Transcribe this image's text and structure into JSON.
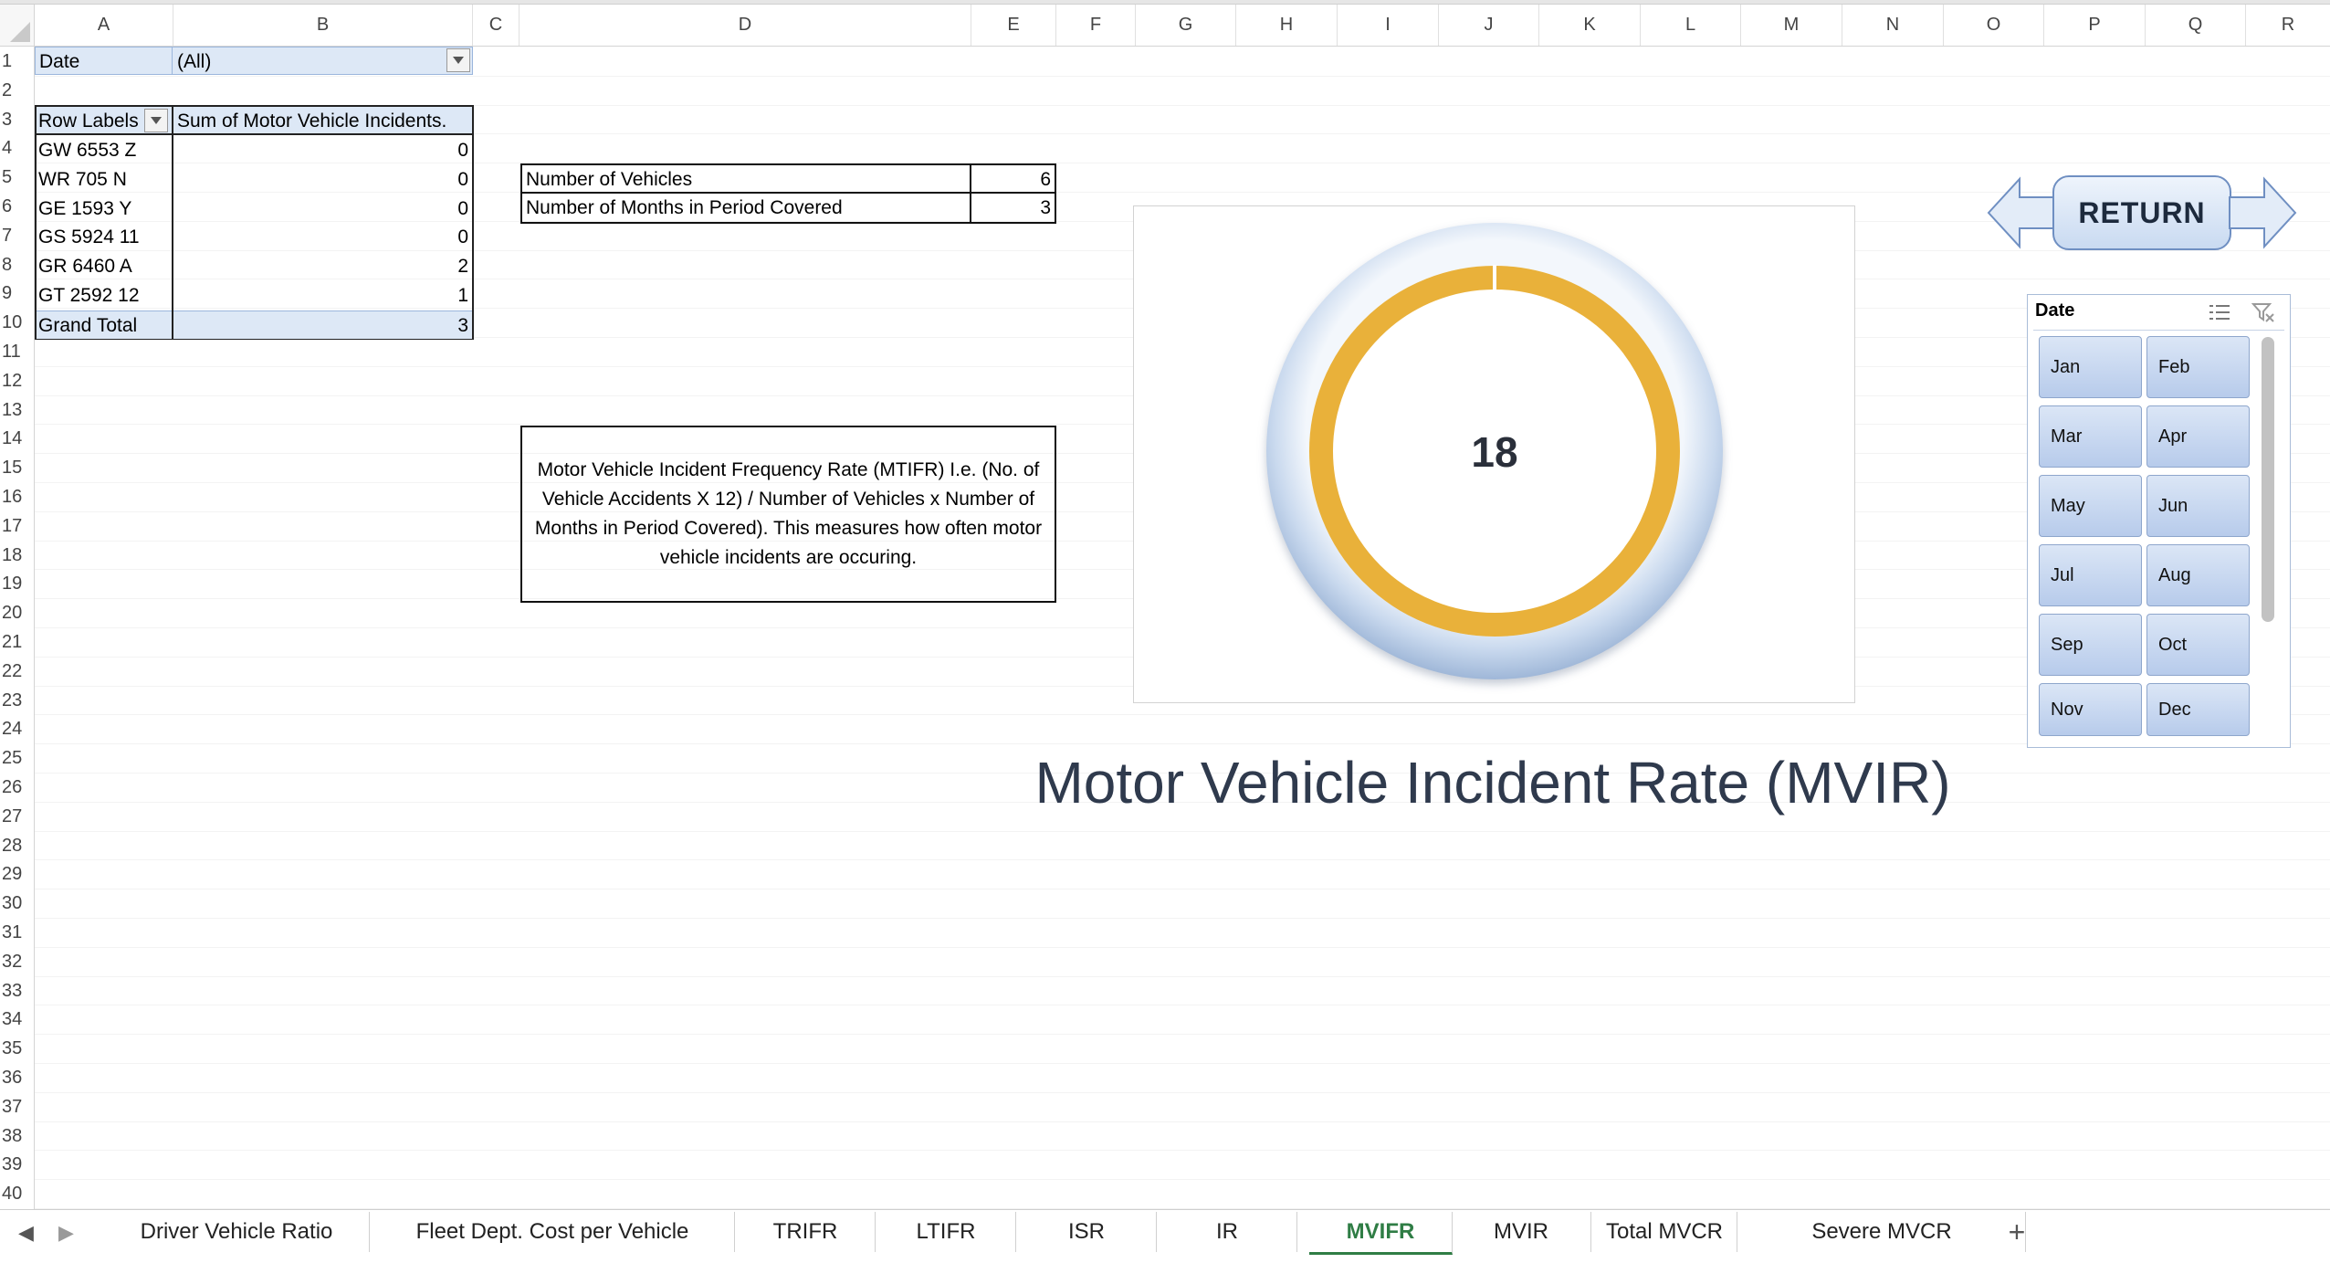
{
  "columns": [
    "A",
    "B",
    "C",
    "D",
    "E",
    "F",
    "G",
    "H",
    "I",
    "J",
    "K",
    "L",
    "M",
    "N",
    "O",
    "P",
    "Q",
    "R"
  ],
  "rows": [
    "1",
    "2",
    "3",
    "4",
    "5",
    "6",
    "7",
    "8",
    "9",
    "10",
    "11",
    "12",
    "13",
    "14",
    "15",
    "16",
    "17",
    "18",
    "19",
    "20",
    "21",
    "22",
    "23",
    "24",
    "25",
    "26",
    "27",
    "28",
    "29",
    "30",
    "31",
    "32",
    "33",
    "34",
    "35",
    "36",
    "37",
    "38",
    "39",
    "40"
  ],
  "pivot": {
    "filter_label": "Date",
    "filter_value": "(All)",
    "row_labels_header": "Row Labels",
    "sum_header": "Sum of Motor Vehicle Incidents.",
    "items": [
      {
        "label": "GW 6553 Z",
        "value": "0"
      },
      {
        "label": "WR 705 N",
        "value": "0"
      },
      {
        "label": "GE 1593 Y",
        "value": "0"
      },
      {
        "label": "GS 5924 11",
        "value": "0"
      },
      {
        "label": "GR 6460 A",
        "value": "2"
      },
      {
        "label": "GT 2592 12",
        "value": "1"
      }
    ],
    "grand_total_label": "Grand Total",
    "grand_total_value": "3"
  },
  "info": {
    "vehicles_label": "Number of Vehicles",
    "vehicles_value": "6",
    "months_label": "Number of Months in Period Covered",
    "months_value": "3"
  },
  "description": "Motor Vehicle Incident Frequency Rate (MTIFR) I.e. (No. of Vehicle Accidents X 12) / Number of Vehicles x Number of Months in Period Covered). This measures how often motor vehicle incidents are occuring.",
  "gauge": {
    "value": "18",
    "ring_color": "#e9b13a",
    "outer_color": "#c4d6ec"
  },
  "chart_title": "Motor Vehicle Incident Rate (MVIR)",
  "return_button": "RETURN",
  "slicer": {
    "title": "Date",
    "months": [
      "Jan",
      "Feb",
      "Mar",
      "Apr",
      "May",
      "Jun",
      "Jul",
      "Aug",
      "Sep",
      "Oct",
      "Nov",
      "Dec"
    ]
  },
  "tabs": [
    {
      "label": "Driver Vehicle Ratio",
      "active": false
    },
    {
      "label": "Fleet Dept. Cost per Vehicle",
      "active": false
    },
    {
      "label": "TRIFR",
      "active": false
    },
    {
      "label": "LTIFR",
      "active": false
    },
    {
      "label": "ISR",
      "active": false
    },
    {
      "label": "IR",
      "active": false
    },
    {
      "label": "MVIFR",
      "active": true
    },
    {
      "label": "MVIR",
      "active": false
    },
    {
      "label": "Total MVCR",
      "active": false
    },
    {
      "label": "Severe MVCR",
      "active": false
    }
  ],
  "add_sheet": "+",
  "colors": {
    "accent": "#2f7d45",
    "slicer": "#b7cbeb"
  }
}
